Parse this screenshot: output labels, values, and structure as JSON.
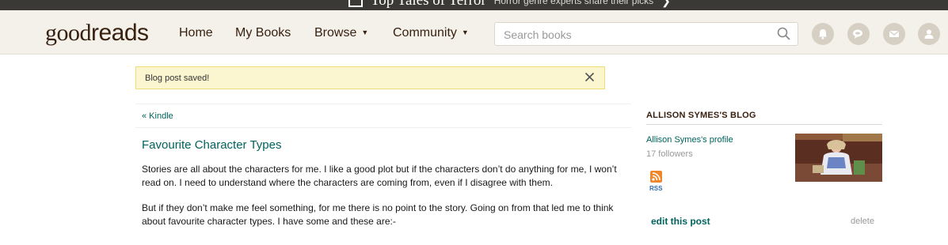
{
  "promo": {
    "title": "Top Tales of Terror",
    "subtitle": "Horror genre experts share their picks",
    "chevron": "❯"
  },
  "header": {
    "logo_good": "good",
    "logo_reads": "reads",
    "nav": [
      {
        "label": "Home"
      },
      {
        "label": "My Books"
      },
      {
        "label": "Browse",
        "caret": "▼"
      },
      {
        "label": "Community",
        "caret": "▼"
      }
    ],
    "search_placeholder": "Search books",
    "icons": [
      "notifications-icon",
      "discussions-icon",
      "messages-icon",
      "friends-icon"
    ]
  },
  "flash": {
    "message": "Blog post saved!"
  },
  "post": {
    "back_link": "« Kindle",
    "title": "Favourite Character Types",
    "paragraphs": [
      "Stories are all about the characters for me. I like a good plot but if the characters don’t do anything for me, I won’t read on. I need to understand where the characters are coming from, even if I disagree with them.",
      "But if they don’t make me feel something, for me there is no point to the story. Going on from that led me to think about favourite character types. I have some and these are:-"
    ]
  },
  "sidebar": {
    "heading": "Allison Symes's Blog",
    "profile_link": "Allison Symes's profile",
    "followers": "17 followers",
    "rss_label": "RSS",
    "edit_link": "edit this post",
    "delete_link": "delete"
  },
  "colors": {
    "header_bg": "#f4f1ea",
    "promo_bg": "#3a3936",
    "link": "#00635d",
    "brand": "#382110",
    "flash_bg": "#fcf6d0"
  }
}
